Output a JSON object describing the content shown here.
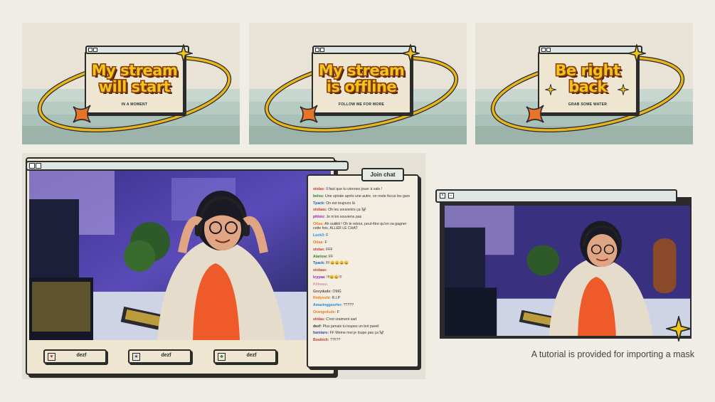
{
  "scenes": [
    {
      "title_line1": "My stream",
      "title_line2": "will start",
      "subtitle": "IN A MOMENT"
    },
    {
      "title_line1": "My stream",
      "title_line2": "is offline",
      "subtitle": "FOLLOW ME FOR MORE"
    },
    {
      "title_line1": "Be right",
      "title_line2": "back",
      "subtitle": "GRAB SOME WATER"
    }
  ],
  "chat": {
    "join_label": "Join chat",
    "messages": [
      {
        "user": "stolas:",
        "text": "Il faut que tu viennes jouer à valo !",
        "color": "#c0392b"
      },
      {
        "user": "belou:",
        "text": "Une spirale après une autre, on reste focus les gars",
        "color": "#2e7d32"
      },
      {
        "user": "Tpack:",
        "text": "On est toujours là",
        "color": "#1565c0"
      },
      {
        "user": "stolaas:",
        "text": "Oh les souvenirs ça 🐼",
        "color": "#c0392b"
      },
      {
        "user": "phloix:",
        "text": "Je m'en souviens pas",
        "color": "#8e24aa"
      },
      {
        "user": "Ottaa:",
        "text": "Ah ouiiiiiii ! Oh le retour, peut-être qu'on va gagner cette fois, ALLER LE CHAT",
        "color": "#e67e22"
      },
      {
        "user": "Luck3:",
        "text": "F",
        "color": "#1e88e5"
      },
      {
        "user": "Ottaa:",
        "text": "F",
        "color": "#e67e22"
      },
      {
        "user": "stolas:",
        "text": "FFF",
        "color": "#c0392b"
      },
      {
        "user": "Alarlow:",
        "text": "FF",
        "color": "#2e7d32"
      },
      {
        "user": "Tpack:",
        "text": "Ff 😀😀😀😀",
        "color": "#1565c0"
      },
      {
        "user": "stolaas:",
        "text": "",
        "color": "#c0392b"
      },
      {
        "user": "Icyyaa:",
        "text": "!!!😀😀!!!",
        "color": "#8e24aa"
      },
      {
        "user": "Killeaas:",
        "text": "",
        "color": "#d88fb0"
      },
      {
        "user": "Greydude:",
        "text": "OMG",
        "color": "#6d4c41"
      },
      {
        "user": "Redyoshi:",
        "text": "R.I.P",
        "color": "#e67e22"
      },
      {
        "user": "Amazinggsurfer:",
        "text": "?????",
        "color": "#1e88e5"
      },
      {
        "user": "Orangedude:",
        "text": "F",
        "color": "#e67e22"
      },
      {
        "user": "stolas:",
        "text": "C'est vraiment sad",
        "color": "#c0392b"
      },
      {
        "user": "dezf:",
        "text": "Plus jamais tu loupes un bot pareil",
        "color": "#333333"
      },
      {
        "user": "hamtaro:",
        "text": "FF Meme moi je loupe pas ça 🐼",
        "color": "#3949ab"
      },
      {
        "user": "Boubich:",
        "text": "??!!??",
        "color": "#c0392b"
      }
    ]
  },
  "alerts": [
    {
      "icon": "♥",
      "label": "dezf",
      "icon_color": "#c0392b"
    },
    {
      "icon": "★",
      "label": "dezf",
      "icon_color": "#3949ab"
    },
    {
      "icon": "♣",
      "label": "dezf",
      "icon_color": "#2e7d32"
    }
  ],
  "caption": "A tutorial is provided for importing a mask",
  "colors": {
    "accent_yellow": "#f0c419",
    "outline": "#2b2b2b",
    "cream": "#efe6d2",
    "mint": "#dfe6e1",
    "orange": "#e8742a"
  }
}
